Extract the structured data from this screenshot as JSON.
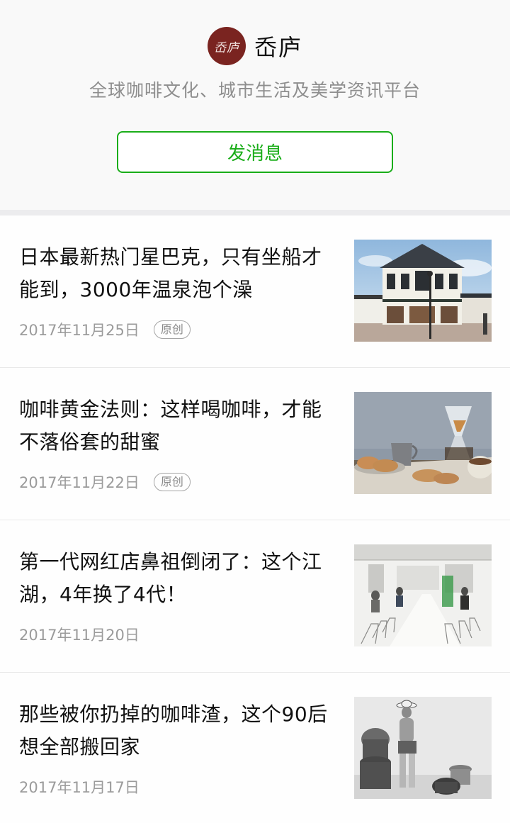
{
  "account": {
    "logo_text": "岙庐",
    "name": "岙庐",
    "tagline": "全球咖啡文化、城市生活及美学资讯平台",
    "message_button_label": "发消息"
  },
  "colors": {
    "accent": "#1aad19",
    "logo_bg": "#7a2420"
  },
  "articles": [
    {
      "title": "日本最新热门星巴克，只有坐船才能到，3000年温泉泡个澡",
      "date": "2017年11月25日",
      "tag": "原创",
      "thumbnail": "starbucks-building-image"
    },
    {
      "title": "咖啡黄金法则：这样喝咖啡，才能不落俗套的甜蜜",
      "date": "2017年11月22日",
      "tag": "原创",
      "thumbnail": "coffee-table-image"
    },
    {
      "title": "第一代网红店鼻祖倒闭了：这个江湖，4年换了4代！",
      "date": "2017年11月20日",
      "thumbnail": "cafe-interior-image"
    },
    {
      "title": "那些被你扔掉的咖啡渣，这个90后想全部搬回家",
      "date": "2017年11月17日",
      "thumbnail": "woman-pottery-image"
    }
  ]
}
